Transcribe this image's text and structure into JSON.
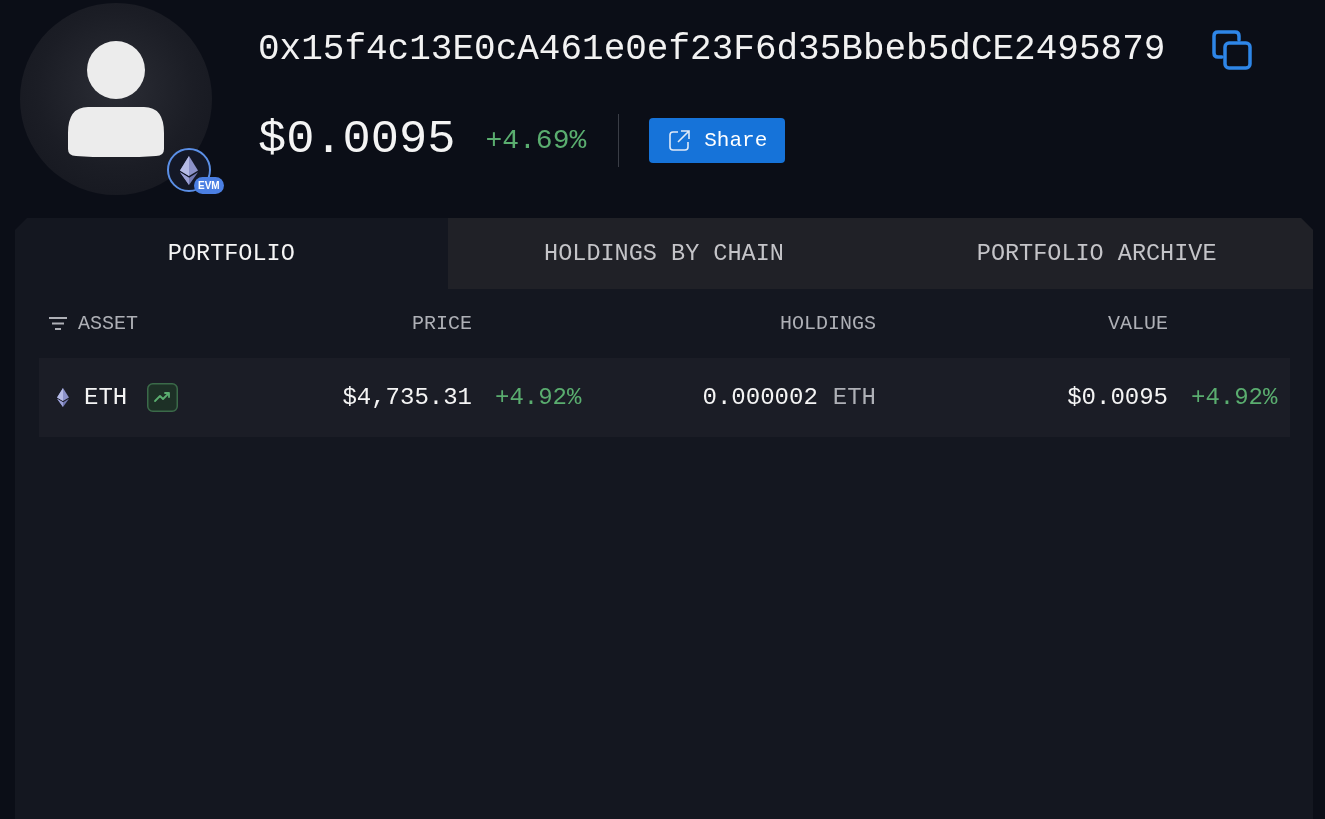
{
  "profile": {
    "address": "0x15f4c13E0cA461e0ef23F6d35Bbeb5dCE2495879",
    "balance": "$0.0095",
    "change": "+4.69%",
    "chain_tag": "EVM"
  },
  "share_button": {
    "label": "Share"
  },
  "tabs": [
    {
      "label": "PORTFOLIO",
      "selected": true
    },
    {
      "label": "HOLDINGS BY CHAIN",
      "selected": false
    },
    {
      "label": "PORTFOLIO ARCHIVE",
      "selected": false
    }
  ],
  "table": {
    "columns": [
      {
        "label": "ASSET",
        "sorted": true
      },
      {
        "label": "PRICE",
        "sorted": false
      },
      {
        "label": "HOLDINGS",
        "sorted": false
      },
      {
        "label": "VALUE",
        "sorted": false
      }
    ],
    "rows": [
      {
        "asset": "ETH",
        "price": "$4,735.31",
        "price_change": "+4.92%",
        "holdings": "0.000002",
        "holdings_unit": "ETH",
        "value": "$0.0095",
        "value_change": "+4.92%"
      }
    ]
  }
}
